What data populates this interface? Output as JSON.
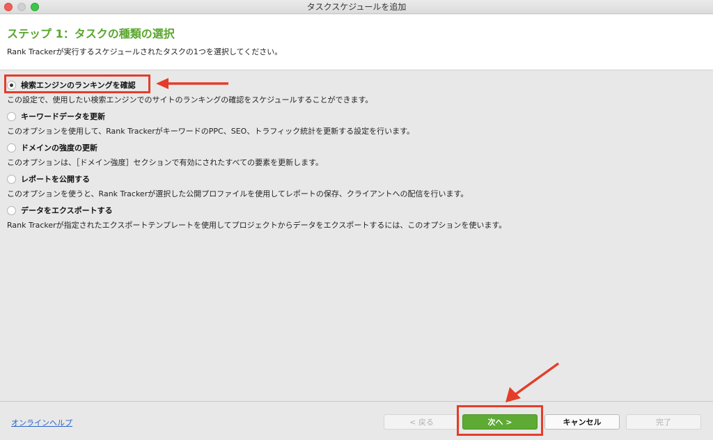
{
  "window": {
    "title": "タスクスケジュールを追加"
  },
  "header": {
    "step_title": "ステップ 1：タスクの種類の選択",
    "description": "Rank Trackerが実行するスケジュールされたタスクの1つを選択してください。"
  },
  "options": [
    {
      "label": "検索エンジンのランキングを確認",
      "description": "この設定で、使用したい検索エンジンでのサイトのランキングの確認をスケジュールすることができます。",
      "selected": true
    },
    {
      "label": "キーワードデータを更新",
      "description": "このオプションを使用して、Rank TrackerがキーワードのPPC、SEO、トラフィック統計を更新する設定を行います。",
      "selected": false
    },
    {
      "label": "ドメインの強度の更新",
      "description": "このオプションは、［ドメイン強度］セクションで有効にされたすべての要素を更新します。",
      "selected": false
    },
    {
      "label": "レポートを公開する",
      "description": "このオプションを使うと、Rank Trackerが選択した公開プロファイルを使用してレポートの保存、クライアントへの配信を行います。",
      "selected": false
    },
    {
      "label": "データをエクスポートする",
      "description": "Rank Trackerが指定されたエクスポートテンプレートを使用してプロジェクトからデータをエクスポートするには、このオプションを使います。",
      "selected": false
    }
  ],
  "footer": {
    "help_link": "オンラインヘルプ",
    "back_label": "< 戻る",
    "next_label": "次へ >",
    "cancel_label": "キャンセル",
    "finish_label": "完了"
  },
  "colors": {
    "accent_green": "#5aa62e",
    "annotation_red": "#e33d2a",
    "link_blue": "#2a62c9"
  }
}
